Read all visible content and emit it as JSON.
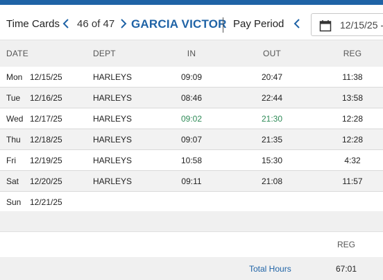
{
  "header": {
    "title": "Time Cards",
    "record_counter": "46 of 47",
    "employee_name": "GARCIA VICTOR",
    "pay_period_label": "Pay Period",
    "date_value": "12/15/25 -"
  },
  "table": {
    "columns": [
      "DATE",
      "DEPT",
      "IN",
      "OUT",
      "REG"
    ],
    "rows": [
      {
        "day": "Mon",
        "date": "12/15/25",
        "dept": "HARLEYS",
        "in": "09:09",
        "out": "20:47",
        "reg": "11:38"
      },
      {
        "day": "Tue",
        "date": "12/16/25",
        "dept": "HARLEYS",
        "in": "08:46",
        "out": "22:44",
        "reg": "13:58"
      },
      {
        "day": "Wed",
        "date": "12/17/25",
        "dept": "HARLEYS",
        "in": "09:02",
        "out": "21:30",
        "reg": "12:28"
      },
      {
        "day": "Thu",
        "date": "12/18/25",
        "dept": "HARLEYS",
        "in": "09:07",
        "out": "21:35",
        "reg": "12:28"
      },
      {
        "day": "Fri",
        "date": "12/19/25",
        "dept": "HARLEYS",
        "in": "10:58",
        "out": "15:30",
        "reg": "4:32"
      },
      {
        "day": "Sat",
        "date": "12/20/25",
        "dept": "HARLEYS",
        "in": "09:11",
        "out": "21:08",
        "reg": "11:57"
      },
      {
        "day": "Sun",
        "date": "12/21/25",
        "dept": "",
        "in": "",
        "out": "",
        "reg": ""
      }
    ]
  },
  "totals": {
    "column_label": "REG",
    "total_label": "Total Hours",
    "total_value": "67:01"
  },
  "colors": {
    "accent": "#1f63a6",
    "highlight_time": "#2e8b57"
  },
  "icons": {
    "prev": "chevron-left-icon",
    "next": "chevron-right-icon",
    "calendar": "calendar-icon"
  }
}
